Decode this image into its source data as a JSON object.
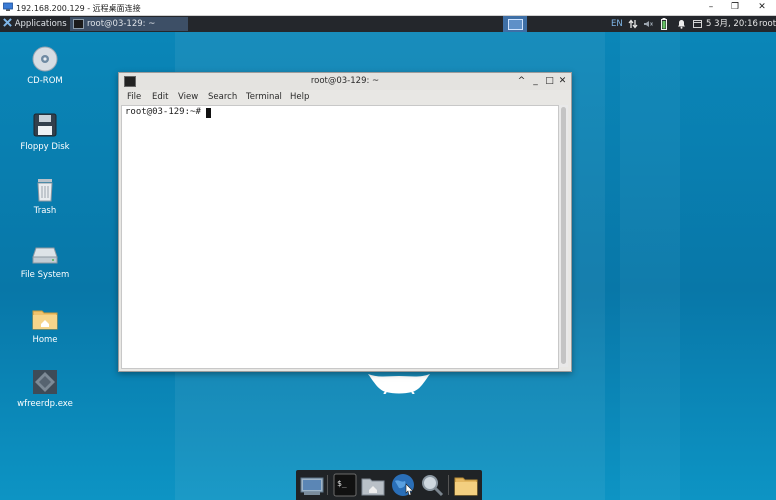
{
  "rdp_window": {
    "title": "192.168.200.129 - 远程桌面连接",
    "minimize": "–",
    "restore": "❐",
    "close": "✕"
  },
  "panel": {
    "applications_label": "Applications :",
    "task_label": "root@03-129: ~",
    "lang": "EN",
    "datetime": "5 3月, 20:16",
    "user": "root",
    "icons": [
      "applications-icon",
      "terminal-task-icon",
      "workspace-icon",
      "network-icon",
      "volume-icon",
      "battery-icon",
      "notification-icon",
      "calendar-icon"
    ]
  },
  "desktop": {
    "icons": [
      {
        "label": "CD-ROM",
        "icon": "cdrom-icon"
      },
      {
        "label": "Floppy Disk",
        "icon": "floppy-icon"
      },
      {
        "label": "Trash",
        "icon": "trash-icon"
      },
      {
        "label": "File System",
        "icon": "drive-icon"
      },
      {
        "label": "Home",
        "icon": "home-folder-icon"
      },
      {
        "label": "wfreerdp.exe",
        "icon": "exe-icon"
      }
    ]
  },
  "terminal": {
    "title": "root@03-129: ~",
    "menu": [
      "File",
      "Edit",
      "View",
      "Search",
      "Terminal",
      "Help"
    ],
    "prompt": "root@03-129:~#",
    "buttons": {
      "up": "^",
      "minimize": "_",
      "maximize": "□",
      "close": "✕"
    }
  },
  "dock": {
    "items": [
      "desktop-icon",
      "terminal-icon",
      "home-icon",
      "web-browser-icon",
      "search-icon",
      "folder-icon"
    ]
  },
  "colors": {
    "desktop_bg": "#0a7fb0",
    "panel_bg": "#24272c",
    "task_active": "#3d4f66",
    "workspace_active": "#3e6fa6"
  }
}
